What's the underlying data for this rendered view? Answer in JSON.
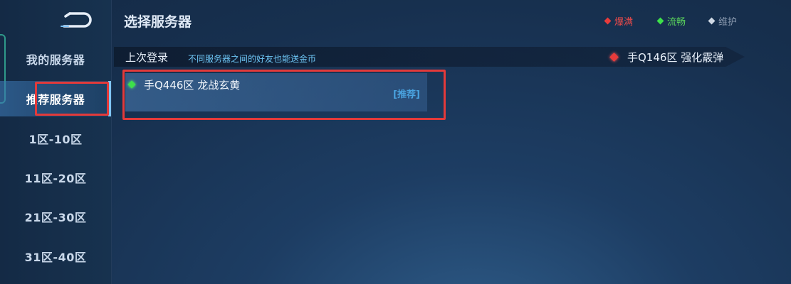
{
  "header": {
    "title": "选择服务器",
    "legend": [
      {
        "label": "爆满",
        "color": "#e83b3b",
        "text_color": "#e84a4a"
      },
      {
        "label": "流畅",
        "color": "#3de04a",
        "text_color": "#5cd85c"
      },
      {
        "label": "维护",
        "color": "#cfd8e4",
        "text_color": "#8c9bb0"
      }
    ]
  },
  "sidebar": {
    "back_icon": "back-arrow-icon",
    "items": [
      {
        "label": "我的服务器",
        "active": false
      },
      {
        "label": "推荐服务器",
        "active": true
      },
      {
        "label": "1区-10区",
        "active": false
      },
      {
        "label": "11区-20区",
        "active": false
      },
      {
        "label": "21区-30区",
        "active": false
      },
      {
        "label": "31区-40区",
        "active": false
      }
    ]
  },
  "last_login": {
    "label": "上次登录",
    "note": "不同服务器之间的好友也能送金币",
    "server": "手Q146区 强化霰弹",
    "status_color": "#e83b3b"
  },
  "servers": [
    {
      "name": "手Q446区 龙战玄黄",
      "tag": "[推荐]",
      "status_color": "#3de04a"
    }
  ],
  "colors": {
    "highlight_box": "#e33a3a",
    "accent": "#7fc4ff"
  }
}
